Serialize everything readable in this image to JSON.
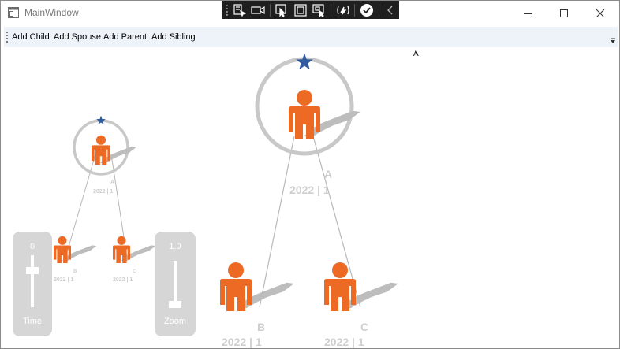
{
  "window": {
    "title": "MainWindow"
  },
  "debug_toolbar": {
    "icons": [
      "go-to-live-tree-icon",
      "select-element-icon",
      "display-layout-adorners-icon",
      "track-focused-element-icon",
      "hot-reload-icon",
      "binding-failures-icon",
      "collapse-toolbar-icon"
    ]
  },
  "menu": {
    "items": [
      "Add Child",
      "Add Spouse",
      "Add Parent",
      "Add Sibling"
    ]
  },
  "canvas": {
    "selected_label": "A"
  },
  "colors": {
    "person": "#ec6a24",
    "star": "#2e5a9e",
    "ring": "#c8c8c8",
    "shadow": "#bdbdbd",
    "link": "#b8b8b8",
    "label": "#d0d0d0"
  },
  "tree_small": {
    "root": {
      "name": "A",
      "date": "2022 | 1"
    },
    "children": [
      {
        "name": "B",
        "date": "2022 | 1"
      },
      {
        "name": "C",
        "date": "2022 | 1"
      }
    ]
  },
  "tree_large": {
    "root": {
      "name": "A",
      "date": "2022 | 1"
    },
    "children": [
      {
        "name": "B",
        "date": "2022 | 1"
      },
      {
        "name": "C",
        "date": "2022 | 1"
      }
    ]
  },
  "time_control": {
    "value": "0",
    "label": "Time",
    "level": 0
  },
  "zoom_control": {
    "value": "1.0",
    "label": "Zoom",
    "level": 0
  }
}
